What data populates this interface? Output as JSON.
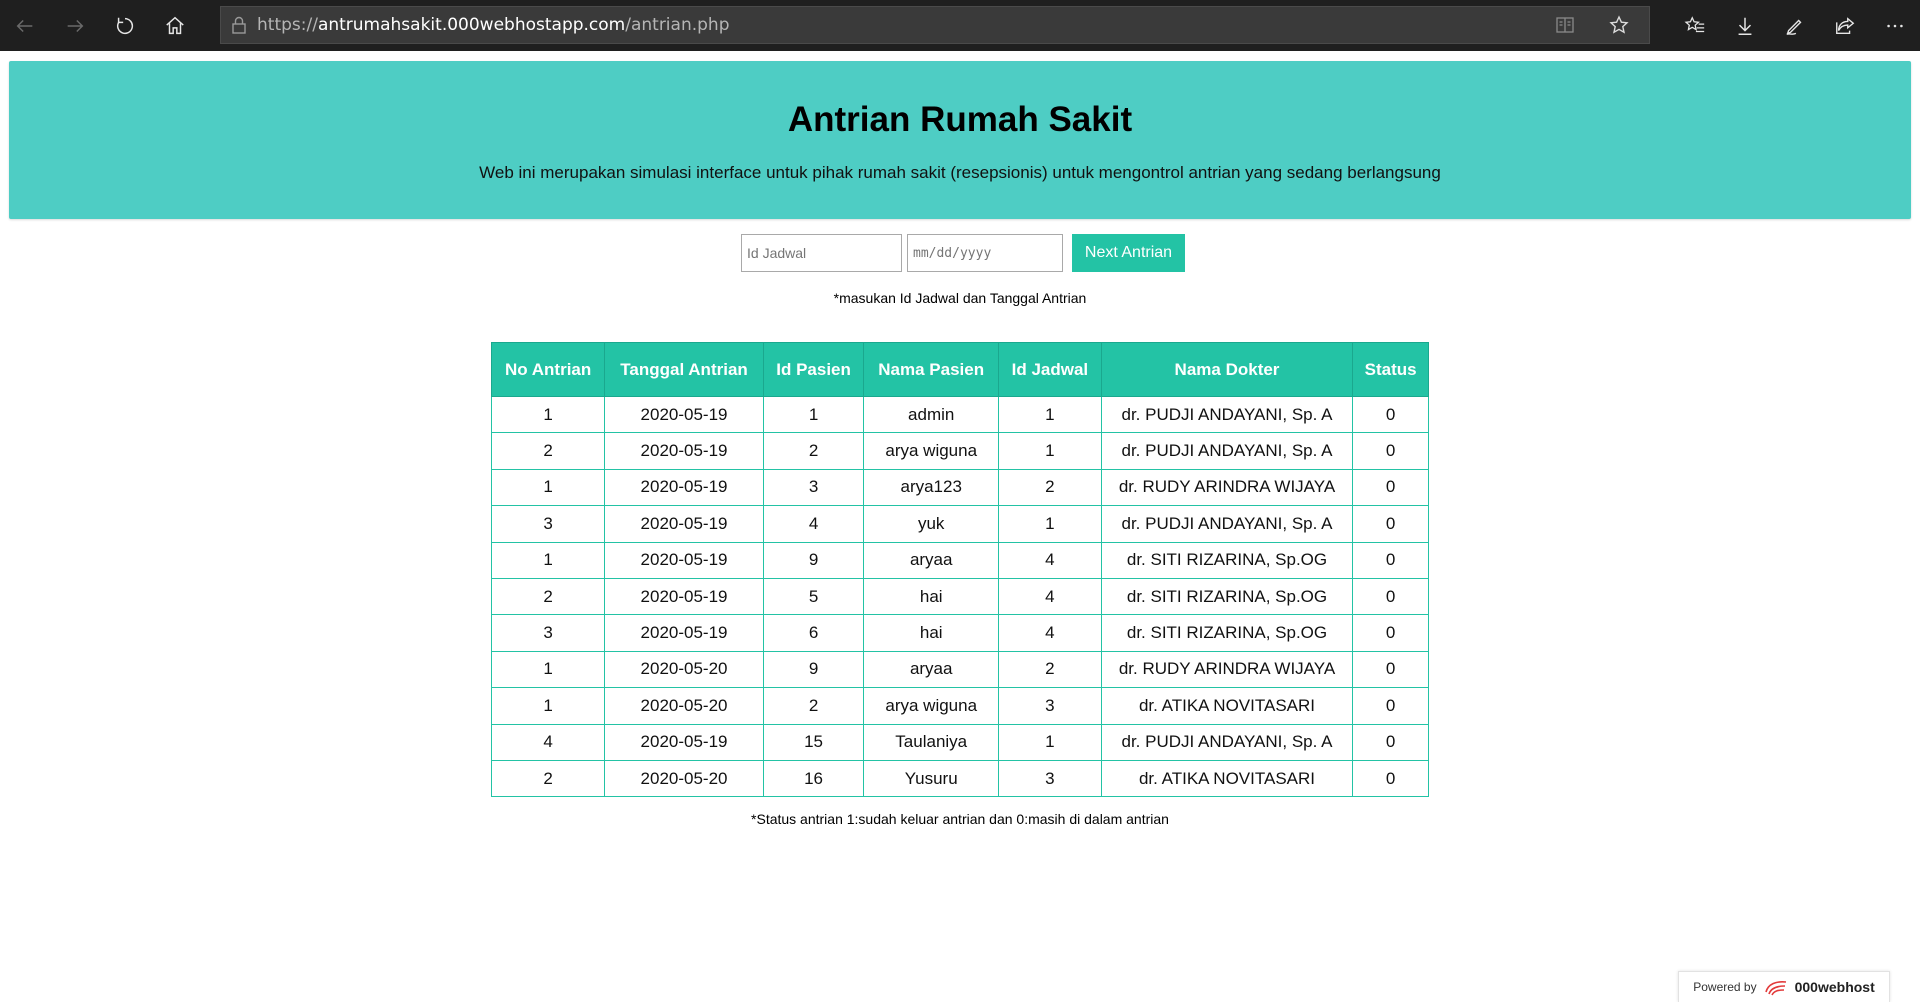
{
  "browser": {
    "url_prefix": "https://",
    "url_host": "antrumahsakit.000webhostapp.com",
    "url_path": "/antrian.php"
  },
  "header": {
    "title": "Antrian Rumah Sakit",
    "subtitle": "Web ini merupakan simulasi interface untuk pihak rumah sakit (resepsionis) untuk mengontrol antrian yang sedang berlangsung"
  },
  "form": {
    "id_placeholder": "Id Jadwal",
    "date_placeholder": "mm/dd/yyyy",
    "next_label": "Next Antrian",
    "hint": "*masukan Id Jadwal dan Tanggal Antrian"
  },
  "table": {
    "headers": [
      "No Antrian",
      "Tanggal Antrian",
      "Id Pasien",
      "Nama Pasien",
      "Id Jadwal",
      "Nama Dokter",
      "Status"
    ],
    "rows": [
      [
        "1",
        "2020-05-19",
        "1",
        "admin",
        "1",
        "dr. PUDJI ANDAYANI, Sp. A",
        "0"
      ],
      [
        "2",
        "2020-05-19",
        "2",
        "arya wiguna",
        "1",
        "dr. PUDJI ANDAYANI, Sp. A",
        "0"
      ],
      [
        "1",
        "2020-05-19",
        "3",
        "arya123",
        "2",
        "dr. RUDY ARINDRA WIJAYA",
        "0"
      ],
      [
        "3",
        "2020-05-19",
        "4",
        "yuk",
        "1",
        "dr. PUDJI ANDAYANI, Sp. A",
        "0"
      ],
      [
        "1",
        "2020-05-19",
        "9",
        "aryaa",
        "4",
        "dr. SITI RIZARINA, Sp.OG",
        "0"
      ],
      [
        "2",
        "2020-05-19",
        "5",
        "hai",
        "4",
        "dr. SITI RIZARINA, Sp.OG",
        "0"
      ],
      [
        "3",
        "2020-05-19",
        "6",
        "hai",
        "4",
        "dr. SITI RIZARINA, Sp.OG",
        "0"
      ],
      [
        "1",
        "2020-05-20",
        "9",
        "aryaa",
        "2",
        "dr. RUDY ARINDRA WIJAYA",
        "0"
      ],
      [
        "1",
        "2020-05-20",
        "2",
        "arya wiguna",
        "3",
        "dr. ATIKA NOVITASARI",
        "0"
      ],
      [
        "4",
        "2020-05-19",
        "15",
        "Taulaniya",
        "1",
        "dr. PUDJI ANDAYANI, Sp. A",
        "0"
      ],
      [
        "2",
        "2020-05-20",
        "16",
        "Yusuru",
        "3",
        "dr. ATIKA NOVITASARI",
        "0"
      ]
    ]
  },
  "footnote": "*Status antrian 1:sudah keluar antrian dan 0:masih di dalam antrian",
  "powered": {
    "label": "Powered by",
    "brand": "000webhost"
  },
  "colors": {
    "header_bg": "#4ecdc4",
    "accent": "#23c3a5",
    "browser_bg": "#1f1f1f"
  }
}
